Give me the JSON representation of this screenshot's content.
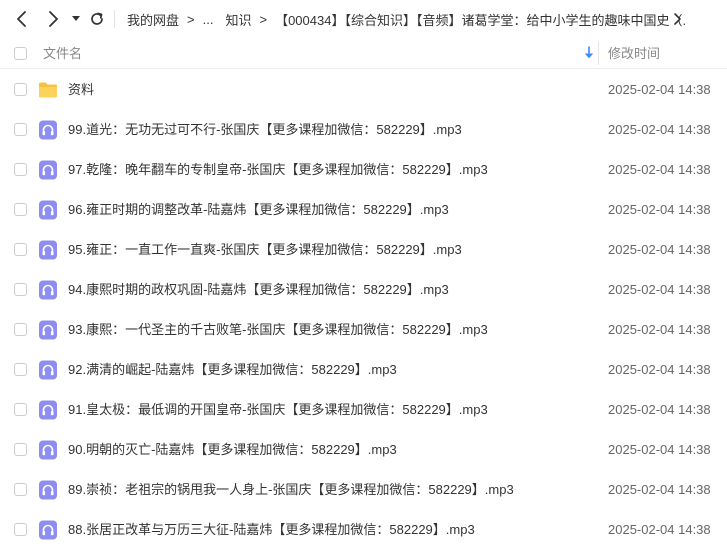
{
  "breadcrumb": {
    "items": [
      "我的网盘",
      "...",
      "知识",
      "【000434】【综合知识】【音频】诸葛学堂：给中小学生的趣味中国史（..."
    ],
    "separator": ">"
  },
  "header": {
    "name_label": "文件名",
    "modified_label": "修改时间"
  },
  "colors": {
    "folder": "#f7c23f",
    "audio_icon": "#8d8df0",
    "sort_arrow": "#3b8cff"
  },
  "files": [
    {
      "name": "资料",
      "type": "folder",
      "modified": "2025-02-04 14:38"
    },
    {
      "name": "99.道光：无功无过可不行-张国庆【更多课程加微信：582229】.mp3",
      "type": "audio",
      "modified": "2025-02-04 14:38"
    },
    {
      "name": "97.乾隆：晚年翻车的专制皇帝-张国庆【更多课程加微信：582229】.mp3",
      "type": "audio",
      "modified": "2025-02-04 14:38"
    },
    {
      "name": "96.雍正时期的调整改革-陆嘉炜【更多课程加微信：582229】.mp3",
      "type": "audio",
      "modified": "2025-02-04 14:38"
    },
    {
      "name": "95.雍正：一直工作一直爽-张国庆【更多课程加微信：582229】.mp3",
      "type": "audio",
      "modified": "2025-02-04 14:38"
    },
    {
      "name": "94.康熙时期的政权巩固-陆嘉炜【更多课程加微信：582229】.mp3",
      "type": "audio",
      "modified": "2025-02-04 14:38"
    },
    {
      "name": "93.康熙：一代圣主的千古败笔-张国庆【更多课程加微信：582229】.mp3",
      "type": "audio",
      "modified": "2025-02-04 14:38"
    },
    {
      "name": "92.满清的崛起-陆嘉炜【更多课程加微信：582229】.mp3",
      "type": "audio",
      "modified": "2025-02-04 14:38"
    },
    {
      "name": "91.皇太极：最低调的开国皇帝-张国庆【更多课程加微信：582229】.mp3",
      "type": "audio",
      "modified": "2025-02-04 14:38"
    },
    {
      "name": "90.明朝的灭亡-陆嘉炜【更多课程加微信：582229】.mp3",
      "type": "audio",
      "modified": "2025-02-04 14:38"
    },
    {
      "name": "89.崇祯：老祖宗的锅甩我一人身上-张国庆【更多课程加微信：582229】.mp3",
      "type": "audio",
      "modified": "2025-02-04 14:38"
    },
    {
      "name": "88.张居正改革与万历三大征-陆嘉炜【更多课程加微信：582229】.mp3",
      "type": "audio",
      "modified": "2025-02-04 14:38"
    }
  ]
}
